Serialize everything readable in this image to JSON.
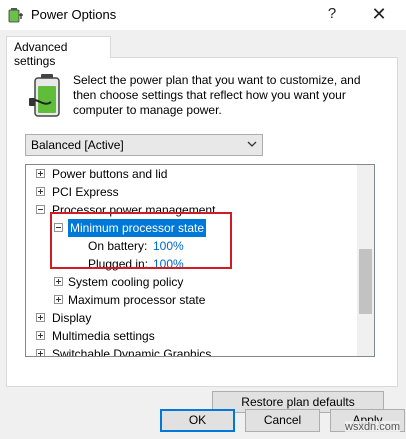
{
  "window": {
    "title": "Power Options",
    "help_label": "?",
    "close_label": "✕"
  },
  "tabs": [
    {
      "label": "Advanced settings"
    }
  ],
  "description": "Select the power plan that you want to customize, and then choose settings that reflect how you want your computer to manage power.",
  "plan_select": {
    "value": "Balanced [Active]"
  },
  "tree": {
    "items": [
      {
        "label": "Power buttons and lid"
      },
      {
        "label": "PCI Express"
      },
      {
        "label": "Processor power management"
      },
      {
        "label": "Minimum processor state"
      },
      {
        "label": "On battery:",
        "value": "100%"
      },
      {
        "label": "Plugged in:",
        "value": "100%"
      },
      {
        "label": "System cooling policy"
      },
      {
        "label": "Maximum processor state"
      },
      {
        "label": "Display"
      },
      {
        "label": "Multimedia settings"
      },
      {
        "label": "Switchable Dynamic Graphics"
      }
    ]
  },
  "buttons": {
    "restore": "Restore plan defaults",
    "ok": "OK",
    "cancel": "Cancel",
    "apply": "Apply"
  },
  "watermark": "wsxdn.com",
  "colors": {
    "selection": "#0078d7",
    "value_link": "#0066cc",
    "highlight_box": "#d01c24"
  }
}
